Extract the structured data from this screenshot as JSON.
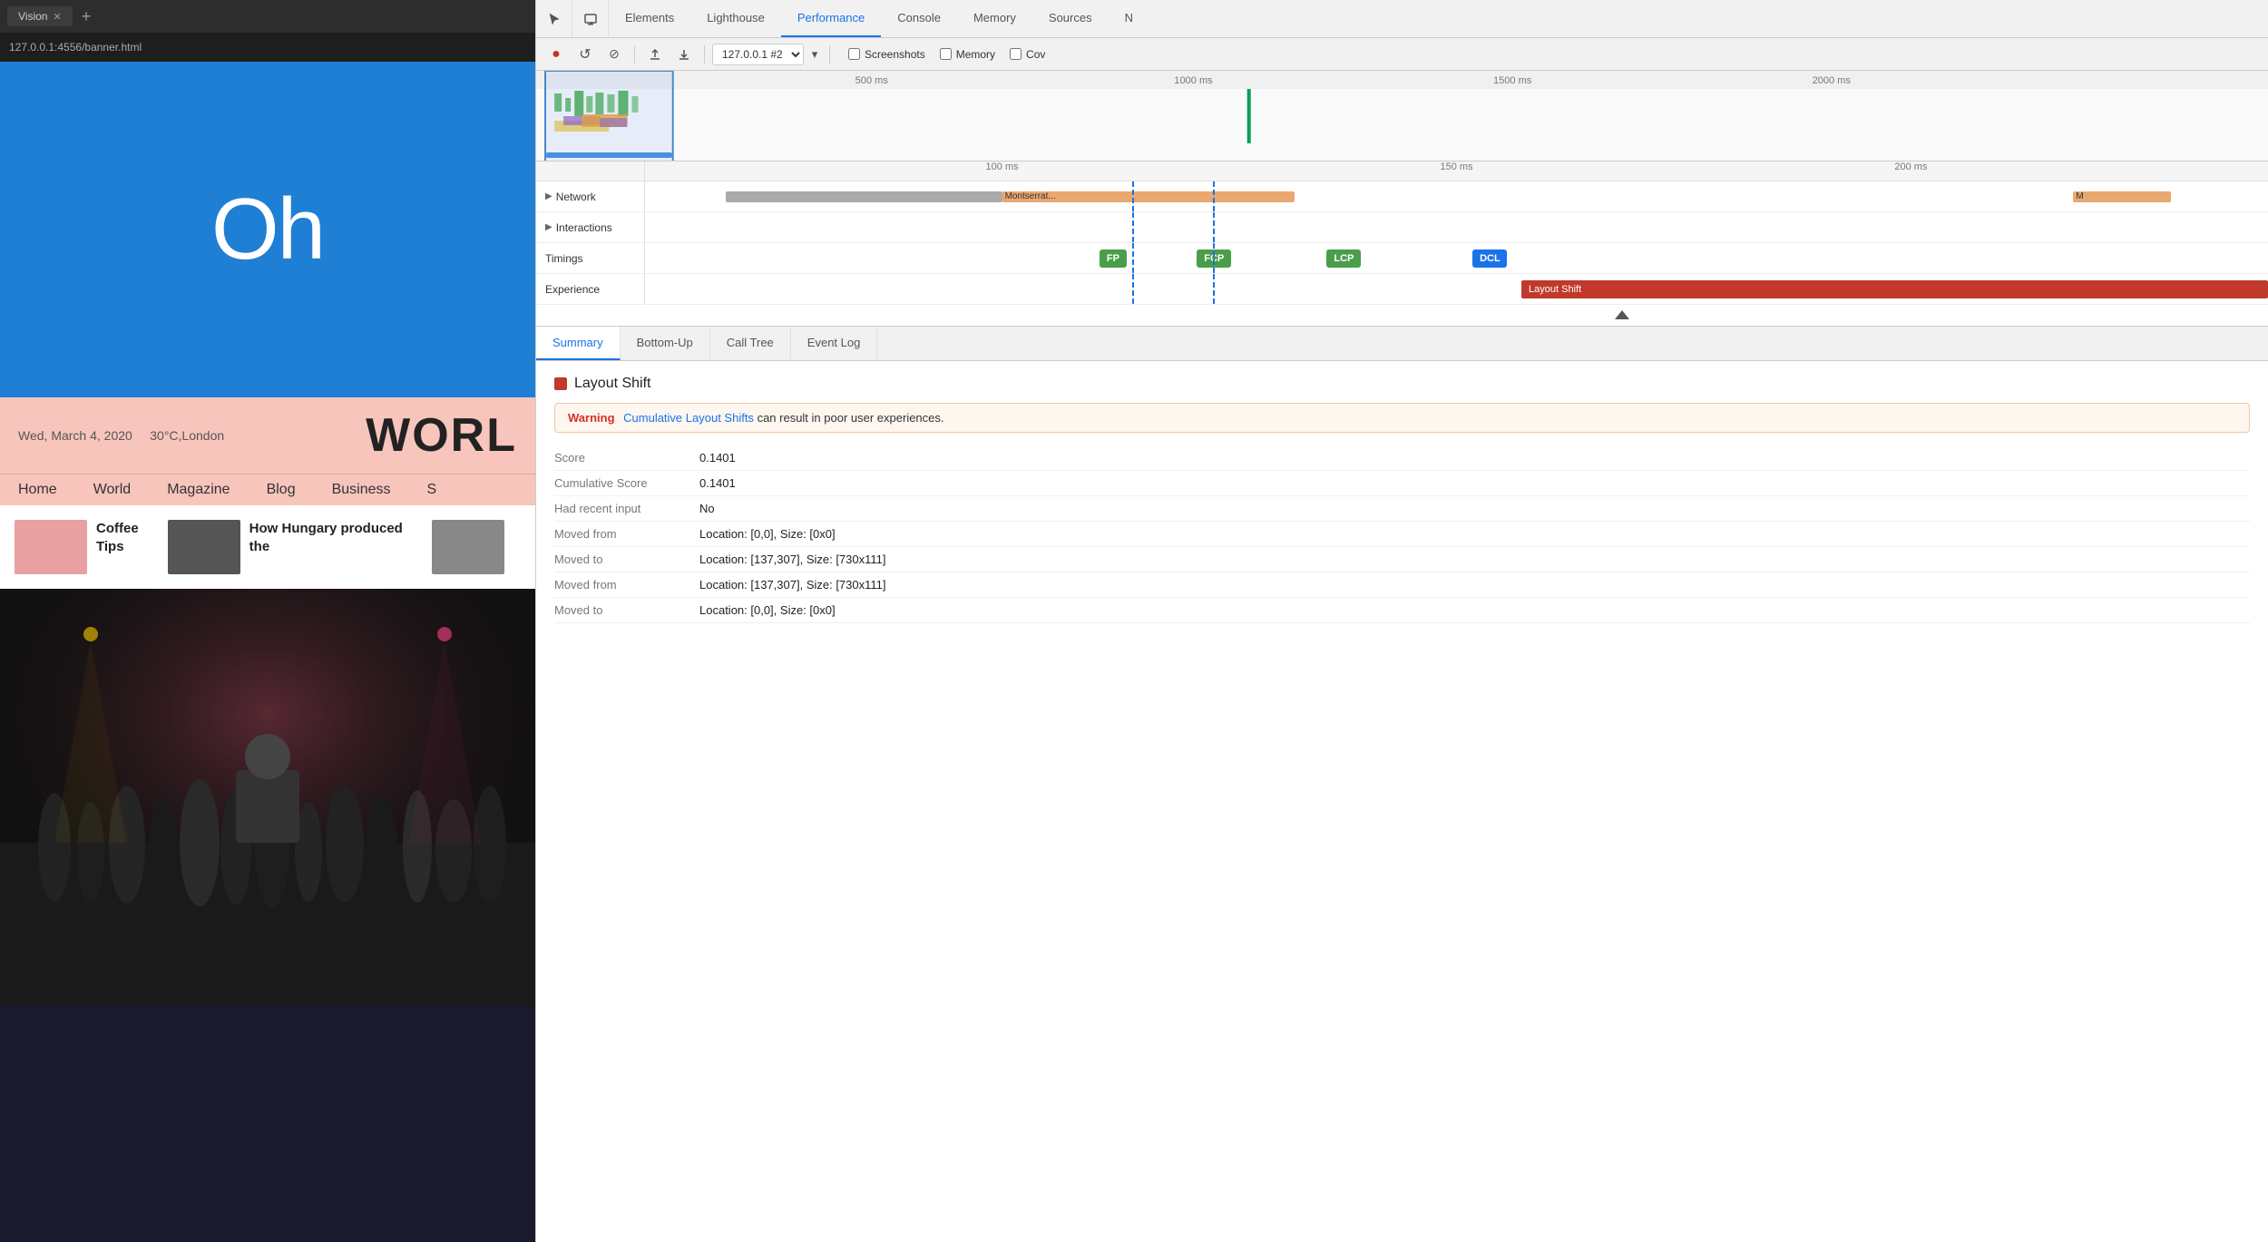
{
  "browser": {
    "tab_title": "Vision",
    "address": "127.0.0.1:4556/banner.html",
    "new_tab_icon": "+"
  },
  "page": {
    "hero_text": "Oh",
    "date": "Wed, March 4, 2020",
    "weather": "30°C,London",
    "world_title": "WORL",
    "nav_items": [
      "Home",
      "World",
      "Magazine",
      "Blog",
      "Business",
      "S"
    ],
    "articles": [
      {
        "title": "Coffee Tips",
        "thumb_color": "pink"
      },
      {
        "title": "How Hungary produced the",
        "thumb_color": "dark"
      },
      {
        "title": "",
        "thumb_color": "gray"
      }
    ]
  },
  "devtools": {
    "tabs": [
      "Elements",
      "Lighthouse",
      "Performance",
      "Console",
      "Memory",
      "Sources",
      "N"
    ],
    "active_tab": "Performance",
    "toolbar": {
      "record_label": "●",
      "reload_label": "↺",
      "clear_label": "⊘",
      "upload_label": "↑",
      "download_label": "↓",
      "profile_select": "127.0.0.1 #2",
      "screenshots_label": "Screenshots",
      "memory_label": "Memory",
      "coverage_label": "Cov"
    },
    "time_markers": [
      "500 ms",
      "1000 ms",
      "1500 ms",
      "2000 ms"
    ],
    "detail_markers": [
      "100 ms",
      "150 ms",
      "200 ms"
    ],
    "tracks": {
      "network_label": "Network",
      "interactions_label": "Interactions",
      "timings_label": "Timings",
      "experience_label": "Experience"
    },
    "network_bars": [
      {
        "label": "Montserrat...",
        "left_pct": 22,
        "width_pct": 15
      },
      {
        "label": "M",
        "left_pct": 88,
        "width_pct": 5
      }
    ],
    "timing_pills": [
      {
        "label": "FP",
        "left_pct": 30,
        "type": "fp"
      },
      {
        "label": "FCP",
        "left_pct": 35,
        "type": "fcp"
      },
      {
        "label": "LCP",
        "left_pct": 43,
        "type": "lcp"
      },
      {
        "label": "DCL",
        "left_pct": 52,
        "type": "dcl"
      }
    ],
    "layout_shift_label": "Layout Shift",
    "bottom_tabs": [
      "Summary",
      "Bottom-Up",
      "Call Tree",
      "Event Log"
    ],
    "active_bottom_tab": "Summary",
    "detail": {
      "section_title": "Layout Shift",
      "warning_label": "Warning",
      "warning_link": "Cumulative Layout Shifts",
      "warning_text": " can result in poor user experiences.",
      "score_label": "Score",
      "score_value": "0.1401",
      "cumulative_score_label": "Cumulative Score",
      "cumulative_score_value": "0.1401",
      "recent_input_label": "Had recent input",
      "recent_input_value": "No",
      "moved_from_1_label": "Moved from",
      "moved_from_1_value": "Location: [0,0], Size: [0x0]",
      "moved_to_1_label": "Moved to",
      "moved_to_1_value": "Location: [137,307], Size: [730x111]",
      "moved_from_2_label": "Moved from",
      "moved_from_2_value": "Location: [137,307], Size: [730x111]",
      "moved_to_2_label": "Moved to",
      "moved_to_2_value": "Location: [0,0], Size: [0x0]"
    }
  }
}
